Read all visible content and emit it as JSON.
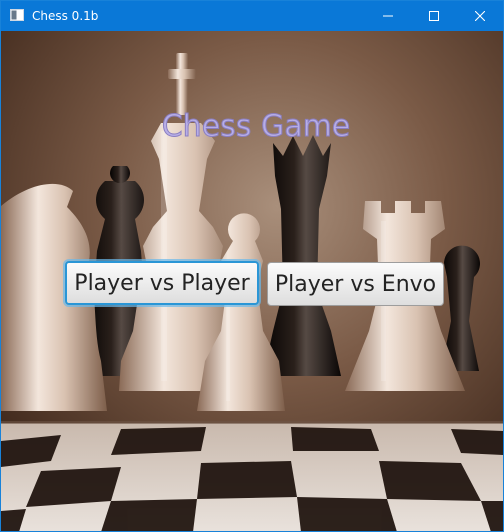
{
  "window": {
    "title": "Chess 0.1b",
    "controls": [
      "minimize-icon",
      "maximize-icon",
      "close-icon"
    ],
    "titlebar_color": "#0a78d7"
  },
  "main": {
    "heading": "Chess Game",
    "buttons": {
      "player_vs_player": "Player vs Player",
      "player_vs_envo": "Player vs Envo"
    },
    "background": "sepia-chess-pieces-photo",
    "accent_color": "#2a96d6"
  }
}
